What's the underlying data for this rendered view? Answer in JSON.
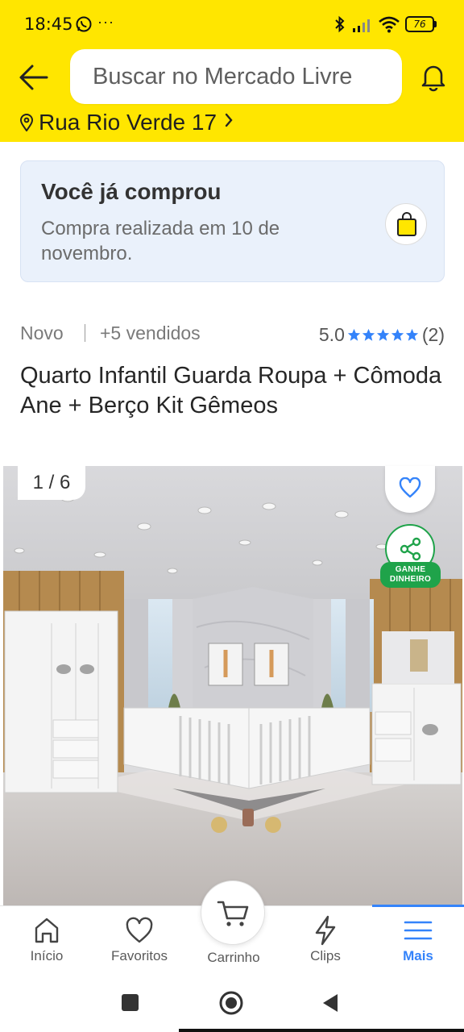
{
  "status_bar": {
    "time": "18:45",
    "more": "···",
    "battery": "76",
    "icons": [
      "whatsapp-icon",
      "bluetooth-icon",
      "signal-icon",
      "wifi-icon",
      "battery-icon"
    ]
  },
  "header": {
    "search_placeholder": "Buscar no Mercado Livre",
    "address": "Rua Rio Verde 17",
    "brand_color": "#ffe600"
  },
  "purchase_notice": {
    "title": "Você já comprou",
    "description": "Compra realizada em 10 de novembro."
  },
  "product": {
    "condition": "Novo",
    "sold": "+5 vendidos",
    "rating_score": "5.0",
    "rating_stars": 5,
    "rating_count": "(2)",
    "title": "Quarto Infantil Guarda Roupa + Cômoda Ane + Berço Kit Gêmeos"
  },
  "gallery": {
    "counter": "1 / 6",
    "earn_label_line1": "GANHE",
    "earn_label_line2": "DINHEIRO"
  },
  "bottom_nav": {
    "items": [
      {
        "label": "Início",
        "icon": "home-icon"
      },
      {
        "label": "Favoritos",
        "icon": "heart-icon"
      },
      {
        "label": "Carrinho",
        "icon": "cart-icon"
      },
      {
        "label": "Clips",
        "icon": "clips-icon"
      },
      {
        "label": "Mais",
        "icon": "menu-icon"
      }
    ],
    "active": "Mais",
    "active_color": "#3483fa"
  }
}
